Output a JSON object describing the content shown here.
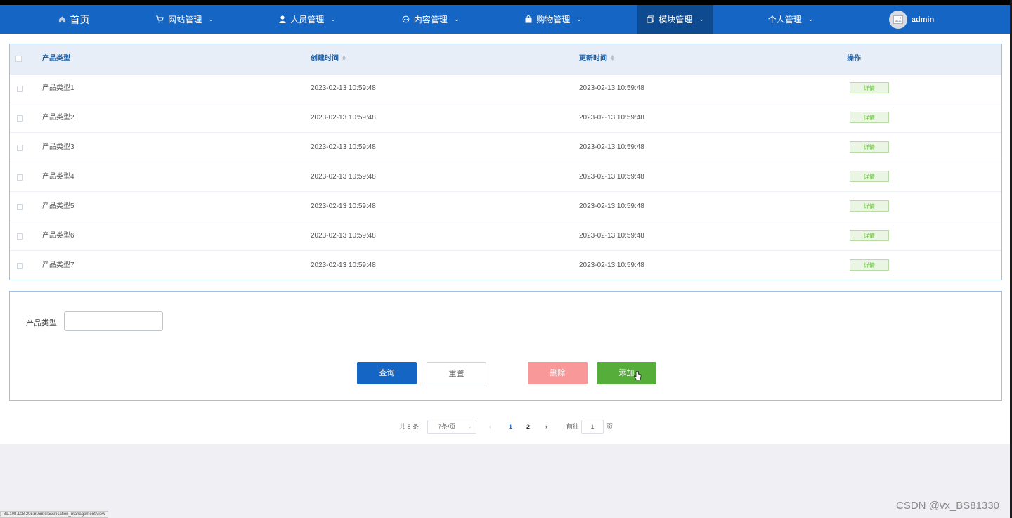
{
  "nav": {
    "home": "首页",
    "items": [
      {
        "label": "网站管理",
        "icon": "cart-icon"
      },
      {
        "label": "人员管理",
        "icon": "user-icon"
      },
      {
        "label": "内容管理",
        "icon": "chat-icon"
      },
      {
        "label": "购物管理",
        "icon": "bag-icon"
      },
      {
        "label": "模块管理",
        "icon": "module-icon",
        "active": true
      },
      {
        "label": "个人管理",
        "icon": ""
      }
    ],
    "user": "admin",
    "color": "#1565c4",
    "active_color": "#0e4a8f"
  },
  "table": {
    "headers": {
      "type": "产品类型",
      "created": "创建时间",
      "updated": "更新时间",
      "actions": "操作"
    },
    "detail_label": "详情",
    "rows": [
      {
        "type": "产品类型1",
        "created": "2023-02-13 10:59:48",
        "updated": "2023-02-13 10:59:48"
      },
      {
        "type": "产品类型2",
        "created": "2023-02-13 10:59:48",
        "updated": "2023-02-13 10:59:48"
      },
      {
        "type": "产品类型3",
        "created": "2023-02-13 10:59:48",
        "updated": "2023-02-13 10:59:48"
      },
      {
        "type": "产品类型4",
        "created": "2023-02-13 10:59:48",
        "updated": "2023-02-13 10:59:48"
      },
      {
        "type": "产品类型5",
        "created": "2023-02-13 10:59:48",
        "updated": "2023-02-13 10:59:48"
      },
      {
        "type": "产品类型6",
        "created": "2023-02-13 10:59:48",
        "updated": "2023-02-13 10:59:48"
      },
      {
        "type": "产品类型7",
        "created": "2023-02-13 10:59:48",
        "updated": "2023-02-13 10:59:48"
      }
    ]
  },
  "search": {
    "label": "产品类型",
    "value": "",
    "query": "查询",
    "reset": "重置",
    "delete": "删除",
    "add": "添加"
  },
  "pagination": {
    "total": "共 8 条",
    "page_size": "7条/页",
    "pages": [
      "1",
      "2"
    ],
    "current": "1",
    "goto_prefix": "前往",
    "goto_value": "1",
    "goto_suffix": "页"
  },
  "status_url": "39.108.108.205:8068/classification_management/view",
  "watermark": "CSDN @vx_BS81330"
}
